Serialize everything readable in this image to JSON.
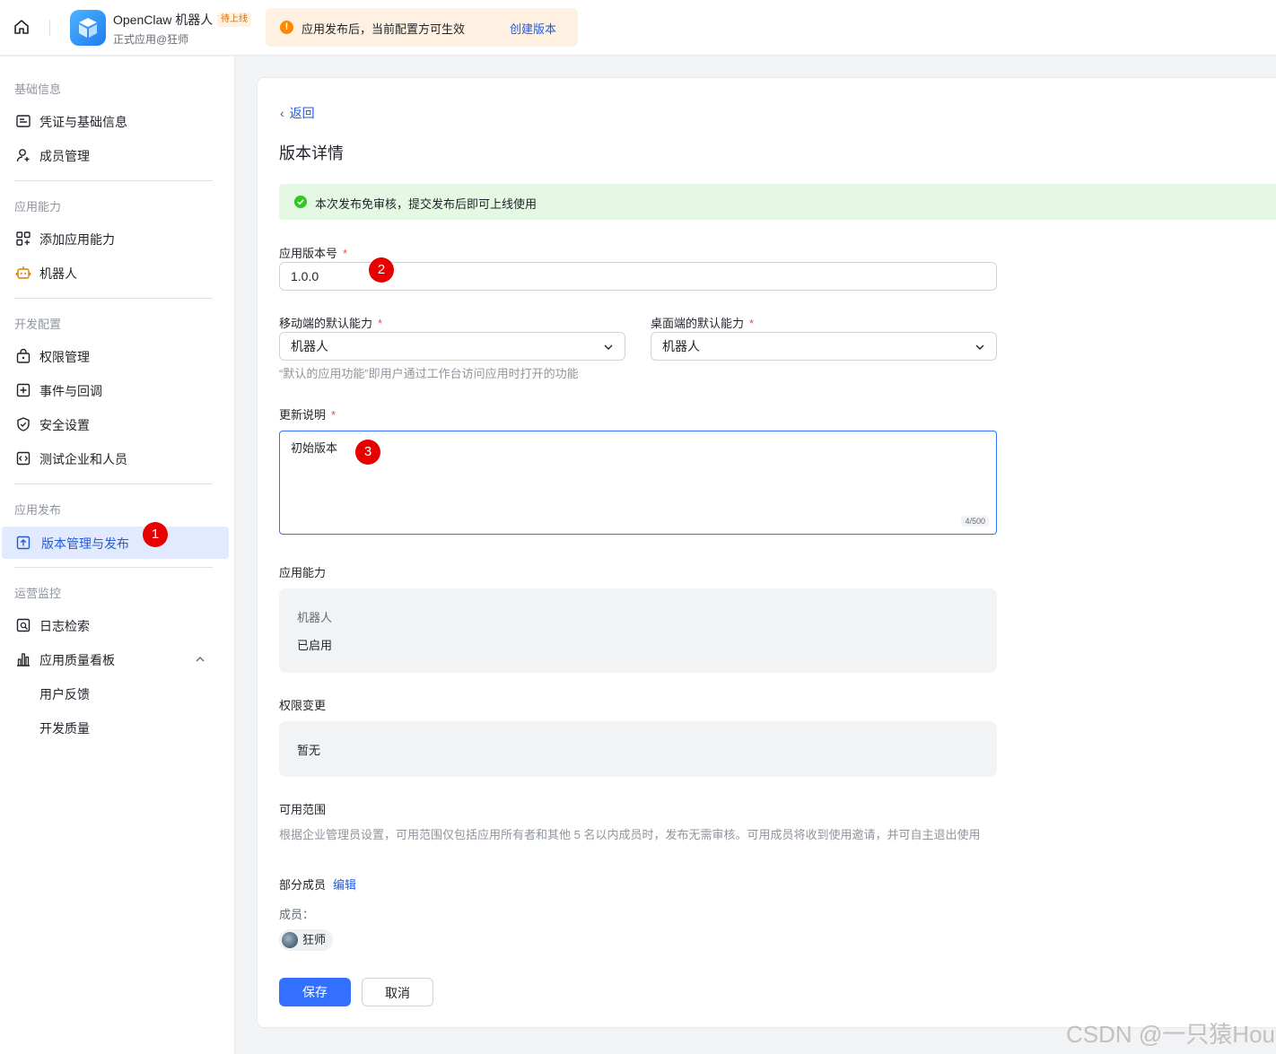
{
  "header": {
    "app_name": "OpenClaw 机器人",
    "status_tag": "待上线",
    "app_sub": "正式应用@狂师",
    "notice_text": "应用发布后，当前配置方可生效",
    "notice_link": "创建版本"
  },
  "sidebar": {
    "sections": {
      "basic": "基础信息",
      "capability": "应用能力",
      "dev": "开发配置",
      "publish": "应用发布",
      "ops": "运营监控"
    },
    "items": {
      "credentials": "凭证与基础信息",
      "members": "成员管理",
      "add_capability": "添加应用能力",
      "bot": "机器人",
      "permissions": "权限管理",
      "events": "事件与回调",
      "security": "安全设置",
      "test": "测试企业和人员",
      "versions": "版本管理与发布",
      "logs": "日志检索",
      "quality": "应用质量看板",
      "feedback": "用户反馈",
      "dev_quality": "开发质量"
    },
    "active_item": "versions"
  },
  "markers": [
    "1",
    "2",
    "3"
  ],
  "main": {
    "back": "返回",
    "title": "版本详情",
    "success_msg": "本次发布免审核，提交发布后即可上线使用",
    "version_label": "应用版本号",
    "version_value": "1.0.0",
    "mobile_label": "移动端的默认能力",
    "mobile_value": "机器人",
    "desktop_label": "桌面端的默认能力",
    "desktop_value": "机器人",
    "default_hint": "“默认的应用功能”即用户通过工作台访问应用时打开的功能",
    "notes_label": "更新说明",
    "notes_value": "初始版本",
    "notes_counter": "4/500",
    "capability_label": "应用能力",
    "capability_name": "机器人",
    "capability_status": "已启用",
    "perm_label": "权限变更",
    "perm_value": "暂无",
    "scope_label": "可用范围",
    "scope_desc": "根据企业管理员设置，可用范围仅包括应用所有者和其他 5 名以内成员时，发布无需审核。可用成员将收到使用邀请，并可自主退出使用",
    "scope_value": "部分成员",
    "scope_edit": "编辑",
    "members_label": "成员：",
    "member_name": "狂师",
    "save": "保存",
    "cancel": "取消"
  },
  "watermark": "CSDN @一只猿Hou",
  "colors": {
    "primary": "#3370ff",
    "link": "#245bdb",
    "success_bg": "#e4f8e3",
    "notice_bg": "#fef1e1",
    "marker": "#e60000",
    "active_bg": "#e1eaff"
  }
}
